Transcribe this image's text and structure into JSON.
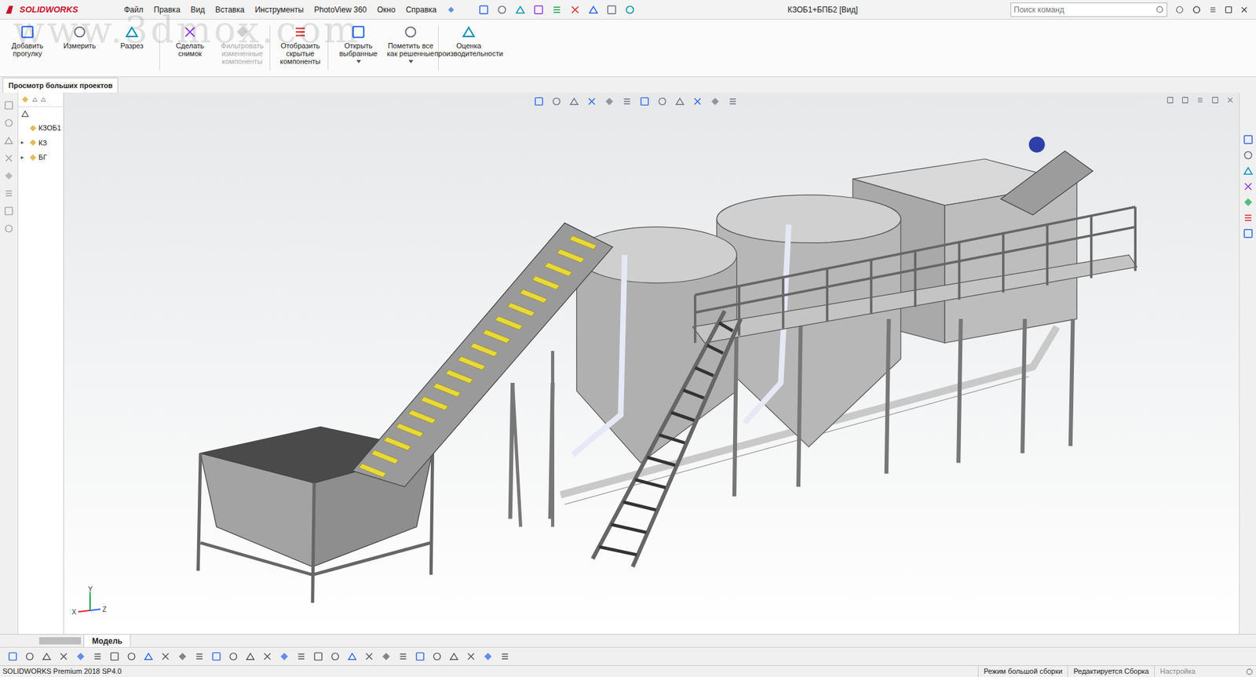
{
  "window": {
    "app": "SOLIDWORKS",
    "title": "КЗОБ1+БПБ2 [Вид]"
  },
  "menu": [
    "Файл",
    "Правка",
    "Вид",
    "Вставка",
    "Инструменты",
    "PhotoView 360",
    "Окно",
    "Справка"
  ],
  "search": {
    "placeholder": "Поиск команд"
  },
  "ribbon": {
    "buttons": [
      {
        "label": "Добавить прогулку",
        "disabled": false,
        "dropdown": false
      },
      {
        "label": "Измерить",
        "disabled": false,
        "dropdown": false
      },
      {
        "label": "Разрез",
        "disabled": false,
        "dropdown": false
      },
      {
        "label": "Сделать снимок",
        "disabled": false,
        "dropdown": false
      },
      {
        "label": "Фильтровать измененные компоненты",
        "disabled": true,
        "dropdown": false
      },
      {
        "label": "Отобразить скрытые компоненты",
        "disabled": false,
        "dropdown": false
      },
      {
        "label": "Открыть выбранные",
        "disabled": false,
        "dropdown": true
      },
      {
        "label": "Пометить все как решенные",
        "disabled": false,
        "dropdown": true
      },
      {
        "label": "Оценка производительности",
        "disabled": false,
        "dropdown": false
      }
    ]
  },
  "ribbon_tabs": [
    {
      "label": "Просмотр больших проектов",
      "selected": true
    }
  ],
  "tree": {
    "items": [
      {
        "label": "КЗОБ1",
        "depth": 0,
        "expanded": true
      },
      {
        "label": "КЗ",
        "depth": 1,
        "expanded": false
      },
      {
        "label": "БГ",
        "depth": 1,
        "expanded": false
      }
    ]
  },
  "axes": [
    "X",
    "Y",
    "Z"
  ],
  "bottom_tabs": [
    {
      "label": "Модель",
      "selected": true
    }
  ],
  "watermark": "www.3dmox.com",
  "status_bar": {
    "version": "SOLIDWORKS Premium 2018 SP4.0",
    "items": [
      "Режим большой сборки",
      "Редактируется Сборка",
      "Настройка"
    ]
  }
}
